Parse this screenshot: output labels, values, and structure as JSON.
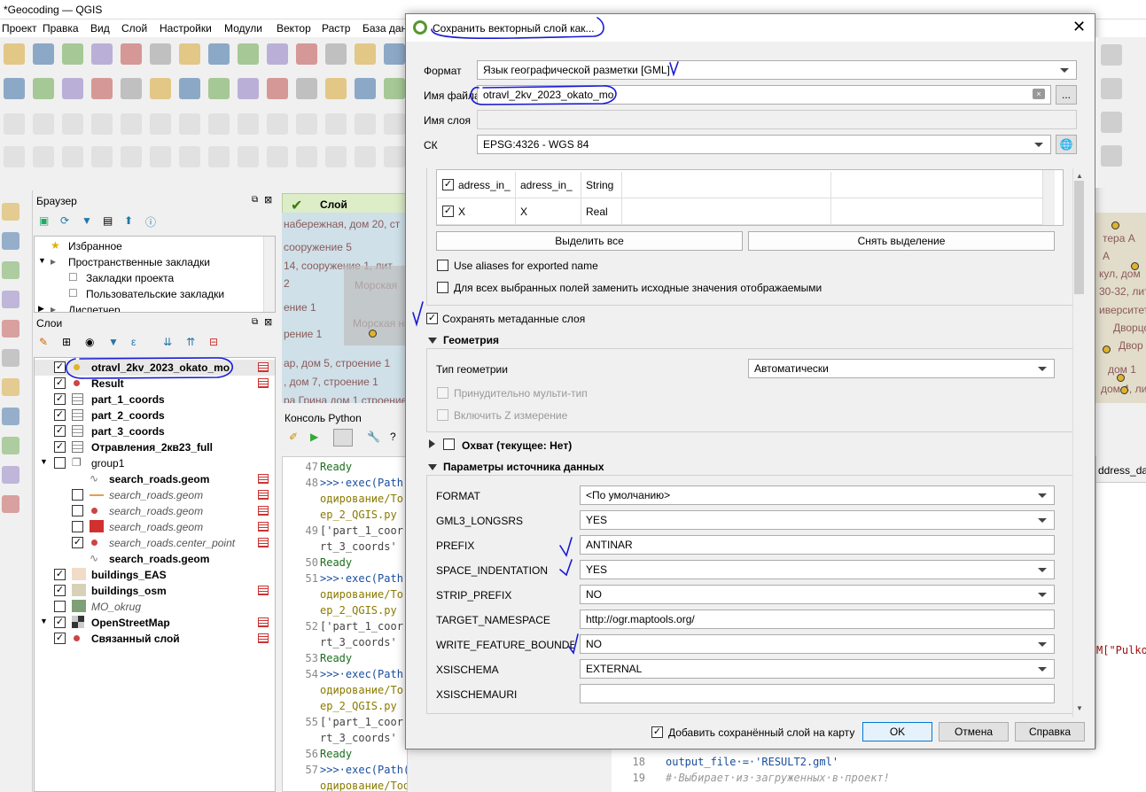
{
  "window": {
    "title": "*Geocoding — QGIS"
  },
  "menu": [
    "Проект",
    "Правка",
    "Вид",
    "Слой",
    "Настройки",
    "Модули",
    "Вектор",
    "Растр",
    "База данн"
  ],
  "browser": {
    "title": "Браузер",
    "items": [
      "Избранное",
      "Пространственные закладки",
      "Закладки проекта",
      "Пользовательские закладки",
      "Диспетчер"
    ]
  },
  "layers": {
    "title": "Слои",
    "items": [
      {
        "name": "otravl_2kv_2023_okato_mo",
        "checked": true
      },
      {
        "name": "Result",
        "checked": true
      },
      {
        "name": "part_1_coords",
        "checked": true
      },
      {
        "name": "part_2_coords",
        "checked": true
      },
      {
        "name": "part_3_coords",
        "checked": true
      },
      {
        "name": "Отравления_2кв23_full",
        "checked": true
      },
      {
        "name": "group1",
        "checked": false
      },
      {
        "name": "search_roads.geom",
        "checked": null
      },
      {
        "name": "search_roads.geom",
        "checked": false
      },
      {
        "name": "search_roads.geom",
        "checked": false
      },
      {
        "name": "search_roads.geom",
        "checked": false
      },
      {
        "name": "search_roads.center_point",
        "checked": true
      },
      {
        "name": "search_roads.geom",
        "checked": null
      },
      {
        "name": "buildings_EAS",
        "checked": true
      },
      {
        "name": "buildings_osm",
        "checked": true
      },
      {
        "name": "MO_okrug",
        "checked": false
      },
      {
        "name": "OpenStreetMap",
        "checked": true
      },
      {
        "name": "Связанный слой",
        "checked": true
      }
    ]
  },
  "message_bar": {
    "text": "Слой экспортиро"
  },
  "map_labels": [
    "набережная, дом 20, ст",
    "сооружение 5",
    "14, сооружение 1, лит",
    "2",
    "Морская",
    "ение 1",
    "рение 1",
    "Морская на",
    "ар, дом 5, строение 1",
    ", дом 7, строение 1",
    "ра Грина дом 1 строение"
  ],
  "map2_labels": [
    "тера А",
    "А",
    "кул, дом",
    "30-32, лит",
    "иверситет",
    "Дворцо",
    "Двор",
    "дом 1",
    "дом 4, лит"
  ],
  "python_console": {
    "title": "Консоль Python",
    "lines": [
      {
        "n": "47",
        "t": "Ready"
      },
      {
        "n": "48",
        "t": ">>>·exec(Path"
      },
      {
        "n": "",
        "t": "одирование/To"
      },
      {
        "n": "",
        "t": "ep_2_QGIS.py"
      },
      {
        "n": "49",
        "t": "['part_1_coor"
      },
      {
        "n": "",
        "t": "rt_3_coords'"
      },
      {
        "n": "50",
        "t": "Ready"
      },
      {
        "n": "51",
        "t": ">>>·exec(Path"
      },
      {
        "n": "",
        "t": "одирование/To"
      },
      {
        "n": "",
        "t": "ep_2_QGIS.py"
      },
      {
        "n": "52",
        "t": "['part_1_coor"
      },
      {
        "n": "",
        "t": "rt_3_coords'"
      },
      {
        "n": "53",
        "t": "Ready"
      },
      {
        "n": "54",
        "t": ">>>·exec(Path"
      },
      {
        "n": "",
        "t": "одирование/To"
      },
      {
        "n": "",
        "t": "ep_2_QGIS.py"
      },
      {
        "n": "55",
        "t": "['part_1_coor"
      },
      {
        "n": "",
        "t": "rt_3_coords'"
      },
      {
        "n": "56",
        "t": "Ready"
      },
      {
        "n": "57",
        "t": ">>>·exec(Path('C:/_Workspace/TASK/Геок"
      },
      {
        "n": "",
        "t": "одирование/Tools/Antinar GeoLocator/st"
      }
    ]
  },
  "editor": {
    "lines": [
      {
        "n": "18",
        "t": "output_file·=·'RESULT2.gml'"
      },
      {
        "n": "19",
        "t": "#·Выбирает·из·загруженных·в·проект!"
      }
    ],
    "tab": "ddress_data",
    "fragment": "M[\"Pulko"
  },
  "dialog": {
    "title": "Сохранить векторный слой как...",
    "format_label": "Формат",
    "format_value": "Язык географической разметки [GML]",
    "filename_label": "Имя файла",
    "filename_value": "otravl_2kv_2023_okato_mo",
    "browse_label": "...",
    "layername_label": "Имя слоя",
    "crs_label": "СК",
    "crs_value": "EPSG:4326 - WGS 84",
    "fields": [
      {
        "name": "adress_in_",
        "export": "adress_in_",
        "type": "String",
        "checked": true
      },
      {
        "name": "X",
        "export": "X",
        "type": "Real",
        "checked": true
      }
    ],
    "select_all": "Выделить все",
    "deselect": "Снять выделение",
    "use_aliases": "Use aliases for exported name",
    "replace_values": "Для всех выбранных полей заменить исходные значения отображаемыми",
    "keep_metadata": "Сохранять метаданные слоя",
    "geometry_section": "Геометрия",
    "geom_type_label": "Тип геометрии",
    "geom_type_value": "Автоматически",
    "force_multi": "Принудительно мульти-тип",
    "include_z": "Включить Z измерение",
    "extent_section": "Охват (текущее: Нет)",
    "ds_section": "Параметры источника данных",
    "ds_options": [
      {
        "key": "FORMAT",
        "value": "<По умолчанию>",
        "kind": "combo"
      },
      {
        "key": "GML3_LONGSRS",
        "value": "YES",
        "kind": "combo"
      },
      {
        "key": "PREFIX",
        "value": "ANTINAR",
        "kind": "text"
      },
      {
        "key": "SPACE_INDENTATION",
        "value": "YES",
        "kind": "combo"
      },
      {
        "key": "STRIP_PREFIX",
        "value": "NO",
        "kind": "combo"
      },
      {
        "key": "TARGET_NAMESPACE",
        "value": "http://ogr.maptools.org/",
        "kind": "text"
      },
      {
        "key": "WRITE_FEATURE_BOUNDED_BY",
        "value": "NO",
        "kind": "combo"
      },
      {
        "key": "XSISCHEMA",
        "value": "EXTERNAL",
        "kind": "combo"
      },
      {
        "key": "XSISCHEMAURI",
        "value": "",
        "kind": "text"
      }
    ],
    "add_to_map": "Добавить сохранённый слой на карту",
    "ok": "OK",
    "cancel": "Отмена",
    "help": "Справка"
  },
  "colors": {
    "accent": "#0078d7",
    "annotation": "#1a1ad6",
    "qgis_green": "#589632"
  }
}
